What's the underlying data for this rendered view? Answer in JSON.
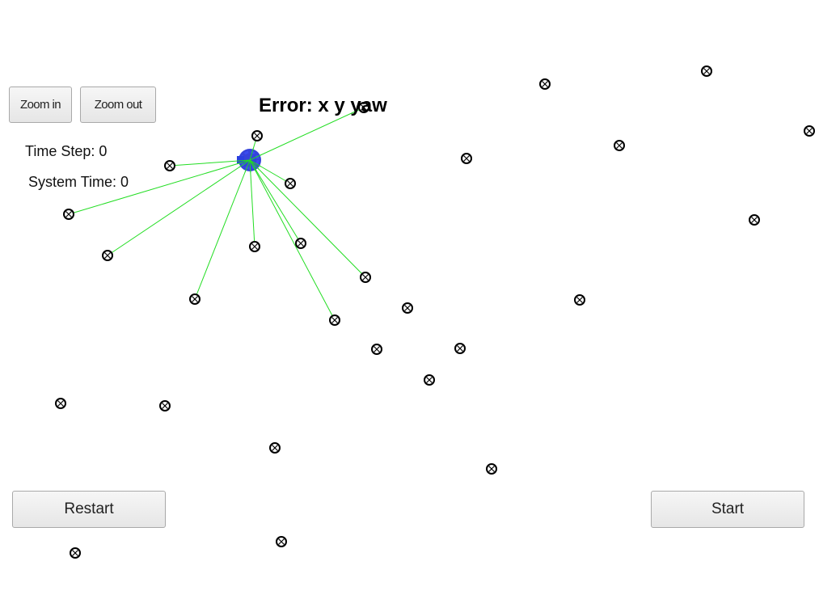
{
  "controls": {
    "zoom_in_label": "Zoom in",
    "zoom_out_label": "Zoom out",
    "restart_label": "Restart",
    "start_label": "Start"
  },
  "status": {
    "time_step_label": "Time Step:",
    "time_step_value": "0",
    "system_time_label": "System Time:",
    "system_time_value": "0",
    "error_label": "Error: x y yaw"
  },
  "colors": {
    "robot": "#1f2fd6",
    "observation_line": "#22dd22",
    "landmark": "#000000"
  },
  "icons": {
    "landmark": "circle-x-icon",
    "robot": "robot-disc-icon"
  }
}
